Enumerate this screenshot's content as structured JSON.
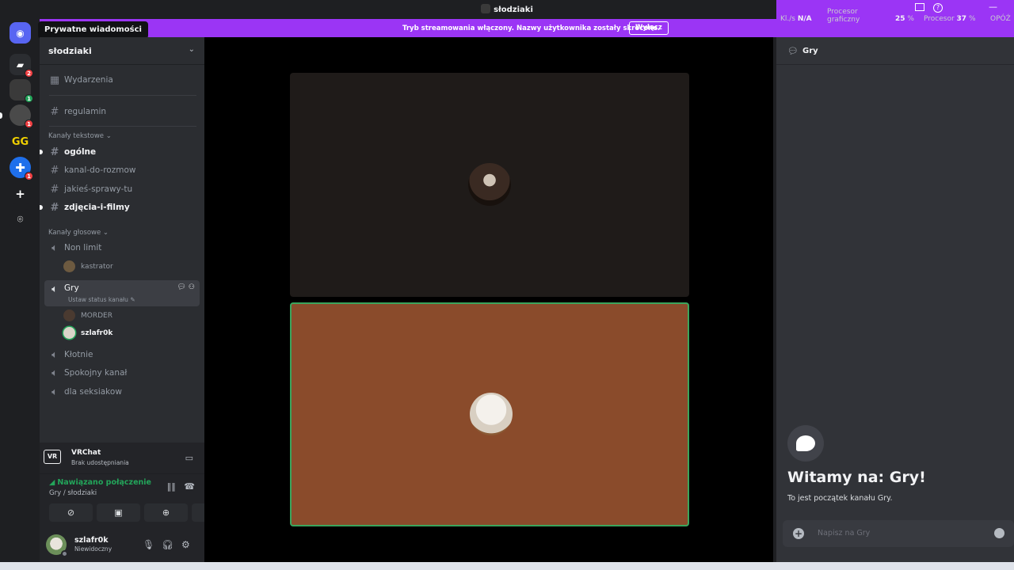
{
  "titlebar": {
    "title": "słodziaki",
    "kbs_label": "Kl./s",
    "kbs_value": "N/A",
    "gpu_label_1": "Procesor",
    "gpu_label_2": "graficzny",
    "gpu_value": "25",
    "cpu_label": "Procesor",
    "cpu_value": "37",
    "delay_label": "OPÓŹ",
    "minimize": "—",
    "help": "?"
  },
  "banner": {
    "text": "Tryb streamowania włączony. Nazwy użytkownika zostały skrócone.",
    "button": "Wyłącz",
    "color": "#9b35f5"
  },
  "rail": {
    "tooltip": "Prywatne wiadomości",
    "badges": [
      "2",
      "1",
      "1",
      "1"
    ],
    "gg_label": "GG",
    "add_glyph": "+",
    "discover_glyph": "⌾"
  },
  "sidebar": {
    "guild_name": "słodziaki",
    "events": "Wydarzenia",
    "regulamin": "regulamin",
    "text_category": "Kanały tekstowe",
    "text_channels": [
      "ogólne",
      "kanal-do-rozmow",
      "jakieś-sprawy-tu",
      "zdjęcia-i-filmy"
    ],
    "voice_category": "Kanały głosowe",
    "voice_channels": {
      "non_limit": "Non limit",
      "non_limit_user": "kastrator",
      "gry": "Gry",
      "gry_status": "Ustaw status kanału",
      "gry_users": [
        "MORDER",
        "szlafr0k"
      ],
      "klotnie": "Kłotnie",
      "spokojny": "Spokojny kanał",
      "seksiakow": "dla seksiakow"
    }
  },
  "activity": {
    "name": "VRChat",
    "status": "Brak udostępniania",
    "logo": "VR"
  },
  "voice_panel": {
    "status": "Nawiązano połączenie",
    "location": "Gry / słodziaki",
    "accent": "#23a55a"
  },
  "user": {
    "name": "szlafr0k",
    "status": "Niewidoczny"
  },
  "chat": {
    "channel": "Gry",
    "welcome_title": "Witamy na: Gry!",
    "welcome_sub": "To jest początek kanału Gry.",
    "placeholder": "Napisz na Gry"
  },
  "stage": {
    "tile_top_color": "#1f1b19",
    "tile_bottom_color": "#8a4b2b",
    "speaking_border": "#3ba55d"
  }
}
